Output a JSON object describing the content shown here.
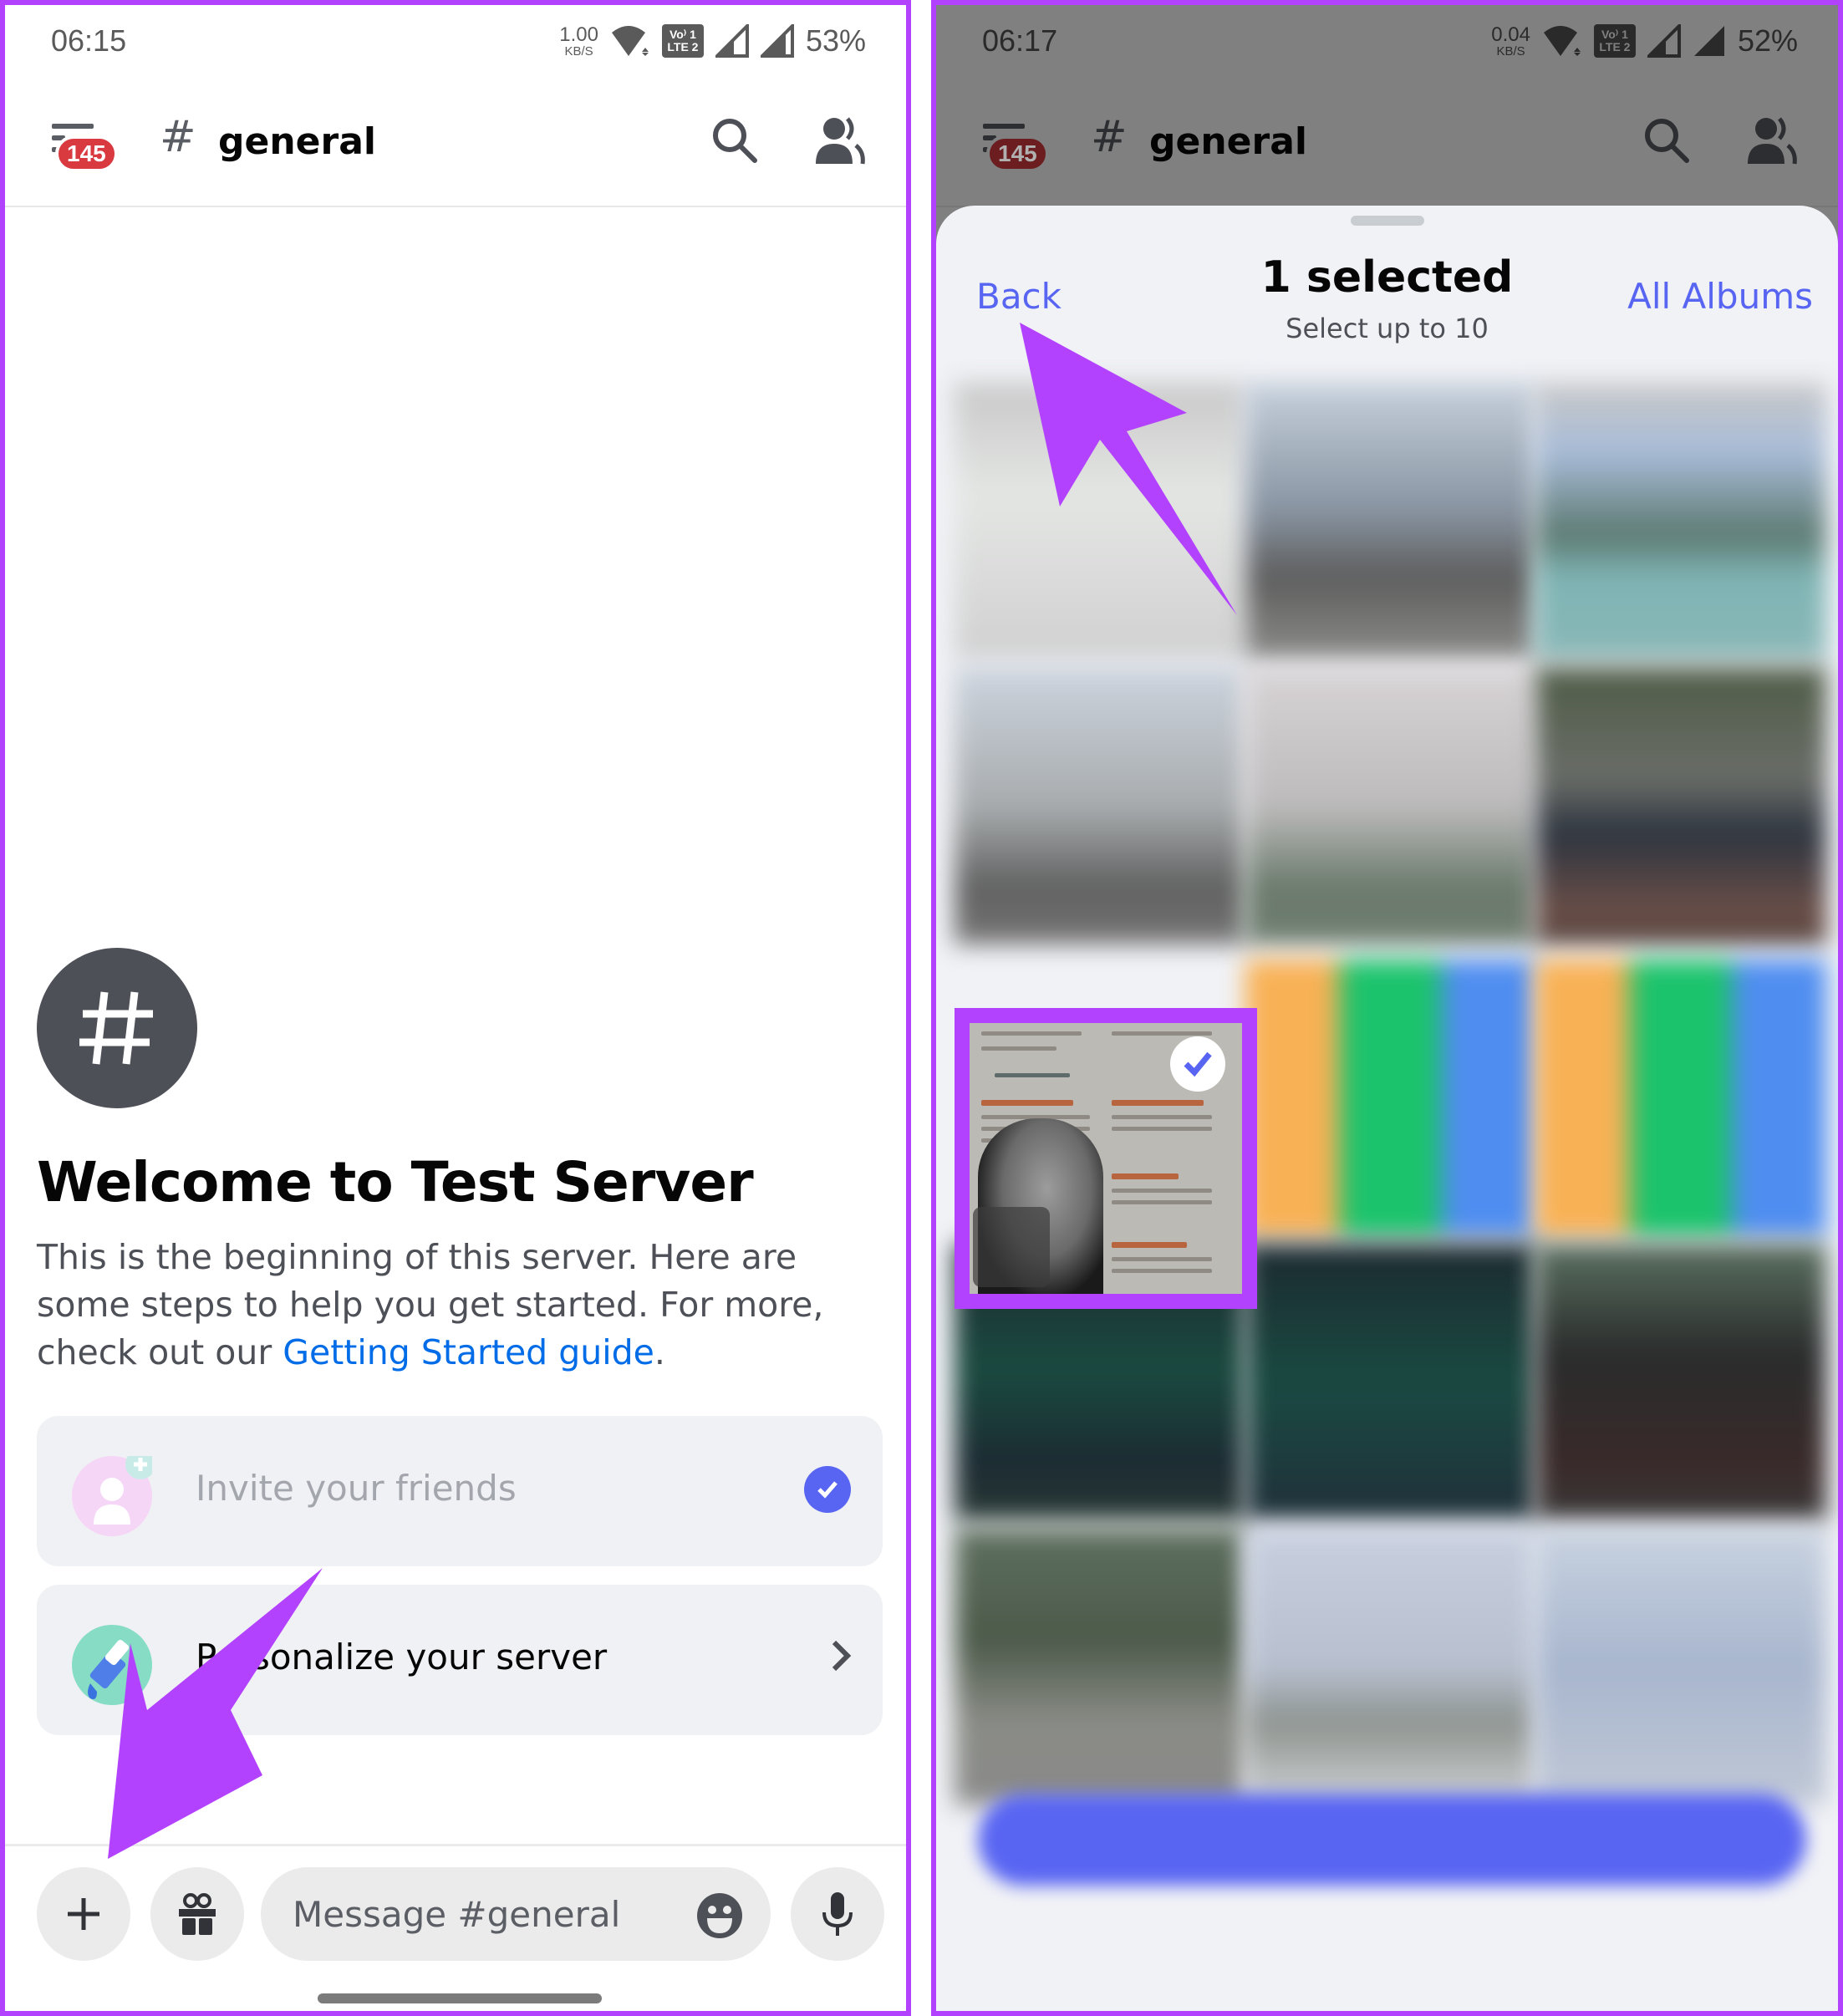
{
  "left_screen": {
    "status_bar": {
      "time": "06:15",
      "net_speed_value": "1.00",
      "net_speed_unit": "KB/S",
      "volte_top": "Vo⁾ 1",
      "volte_bottom": "LTE 2",
      "battery": "53%"
    },
    "header": {
      "unread_badge": "145",
      "channel_name": "general"
    },
    "welcome": {
      "title": "Welcome to Test Server",
      "body_text": "This is the beginning of this server. Here are some steps to help you get started. For more, check out our ",
      "link_text": "Getting Started guide",
      "body_end": "."
    },
    "cards": [
      {
        "label": "Invite your friends",
        "state": "completed"
      },
      {
        "label": "Personalize your server",
        "state": "pending"
      }
    ],
    "composer": {
      "placeholder": "Message #general"
    }
  },
  "right_screen": {
    "status_bar": {
      "time": "06:17",
      "net_speed_value": "0.04",
      "net_speed_unit": "KB/S",
      "volte_top": "Vo⁾ 1",
      "volte_bottom": "LTE 2",
      "battery": "52%"
    },
    "header": {
      "unread_badge": "145",
      "channel_name": "general"
    },
    "picker": {
      "back_label": "Back",
      "title": "1 selected",
      "subtitle": "Select up to 10",
      "albums_label": "All Albums",
      "selected_count": 1,
      "max_selection": 10
    }
  },
  "colors": {
    "annotation_purple": "#b342ff",
    "discord_blurple": "#5865f2",
    "badge_red": "#d83a3f",
    "link_blue": "#006ce7"
  }
}
